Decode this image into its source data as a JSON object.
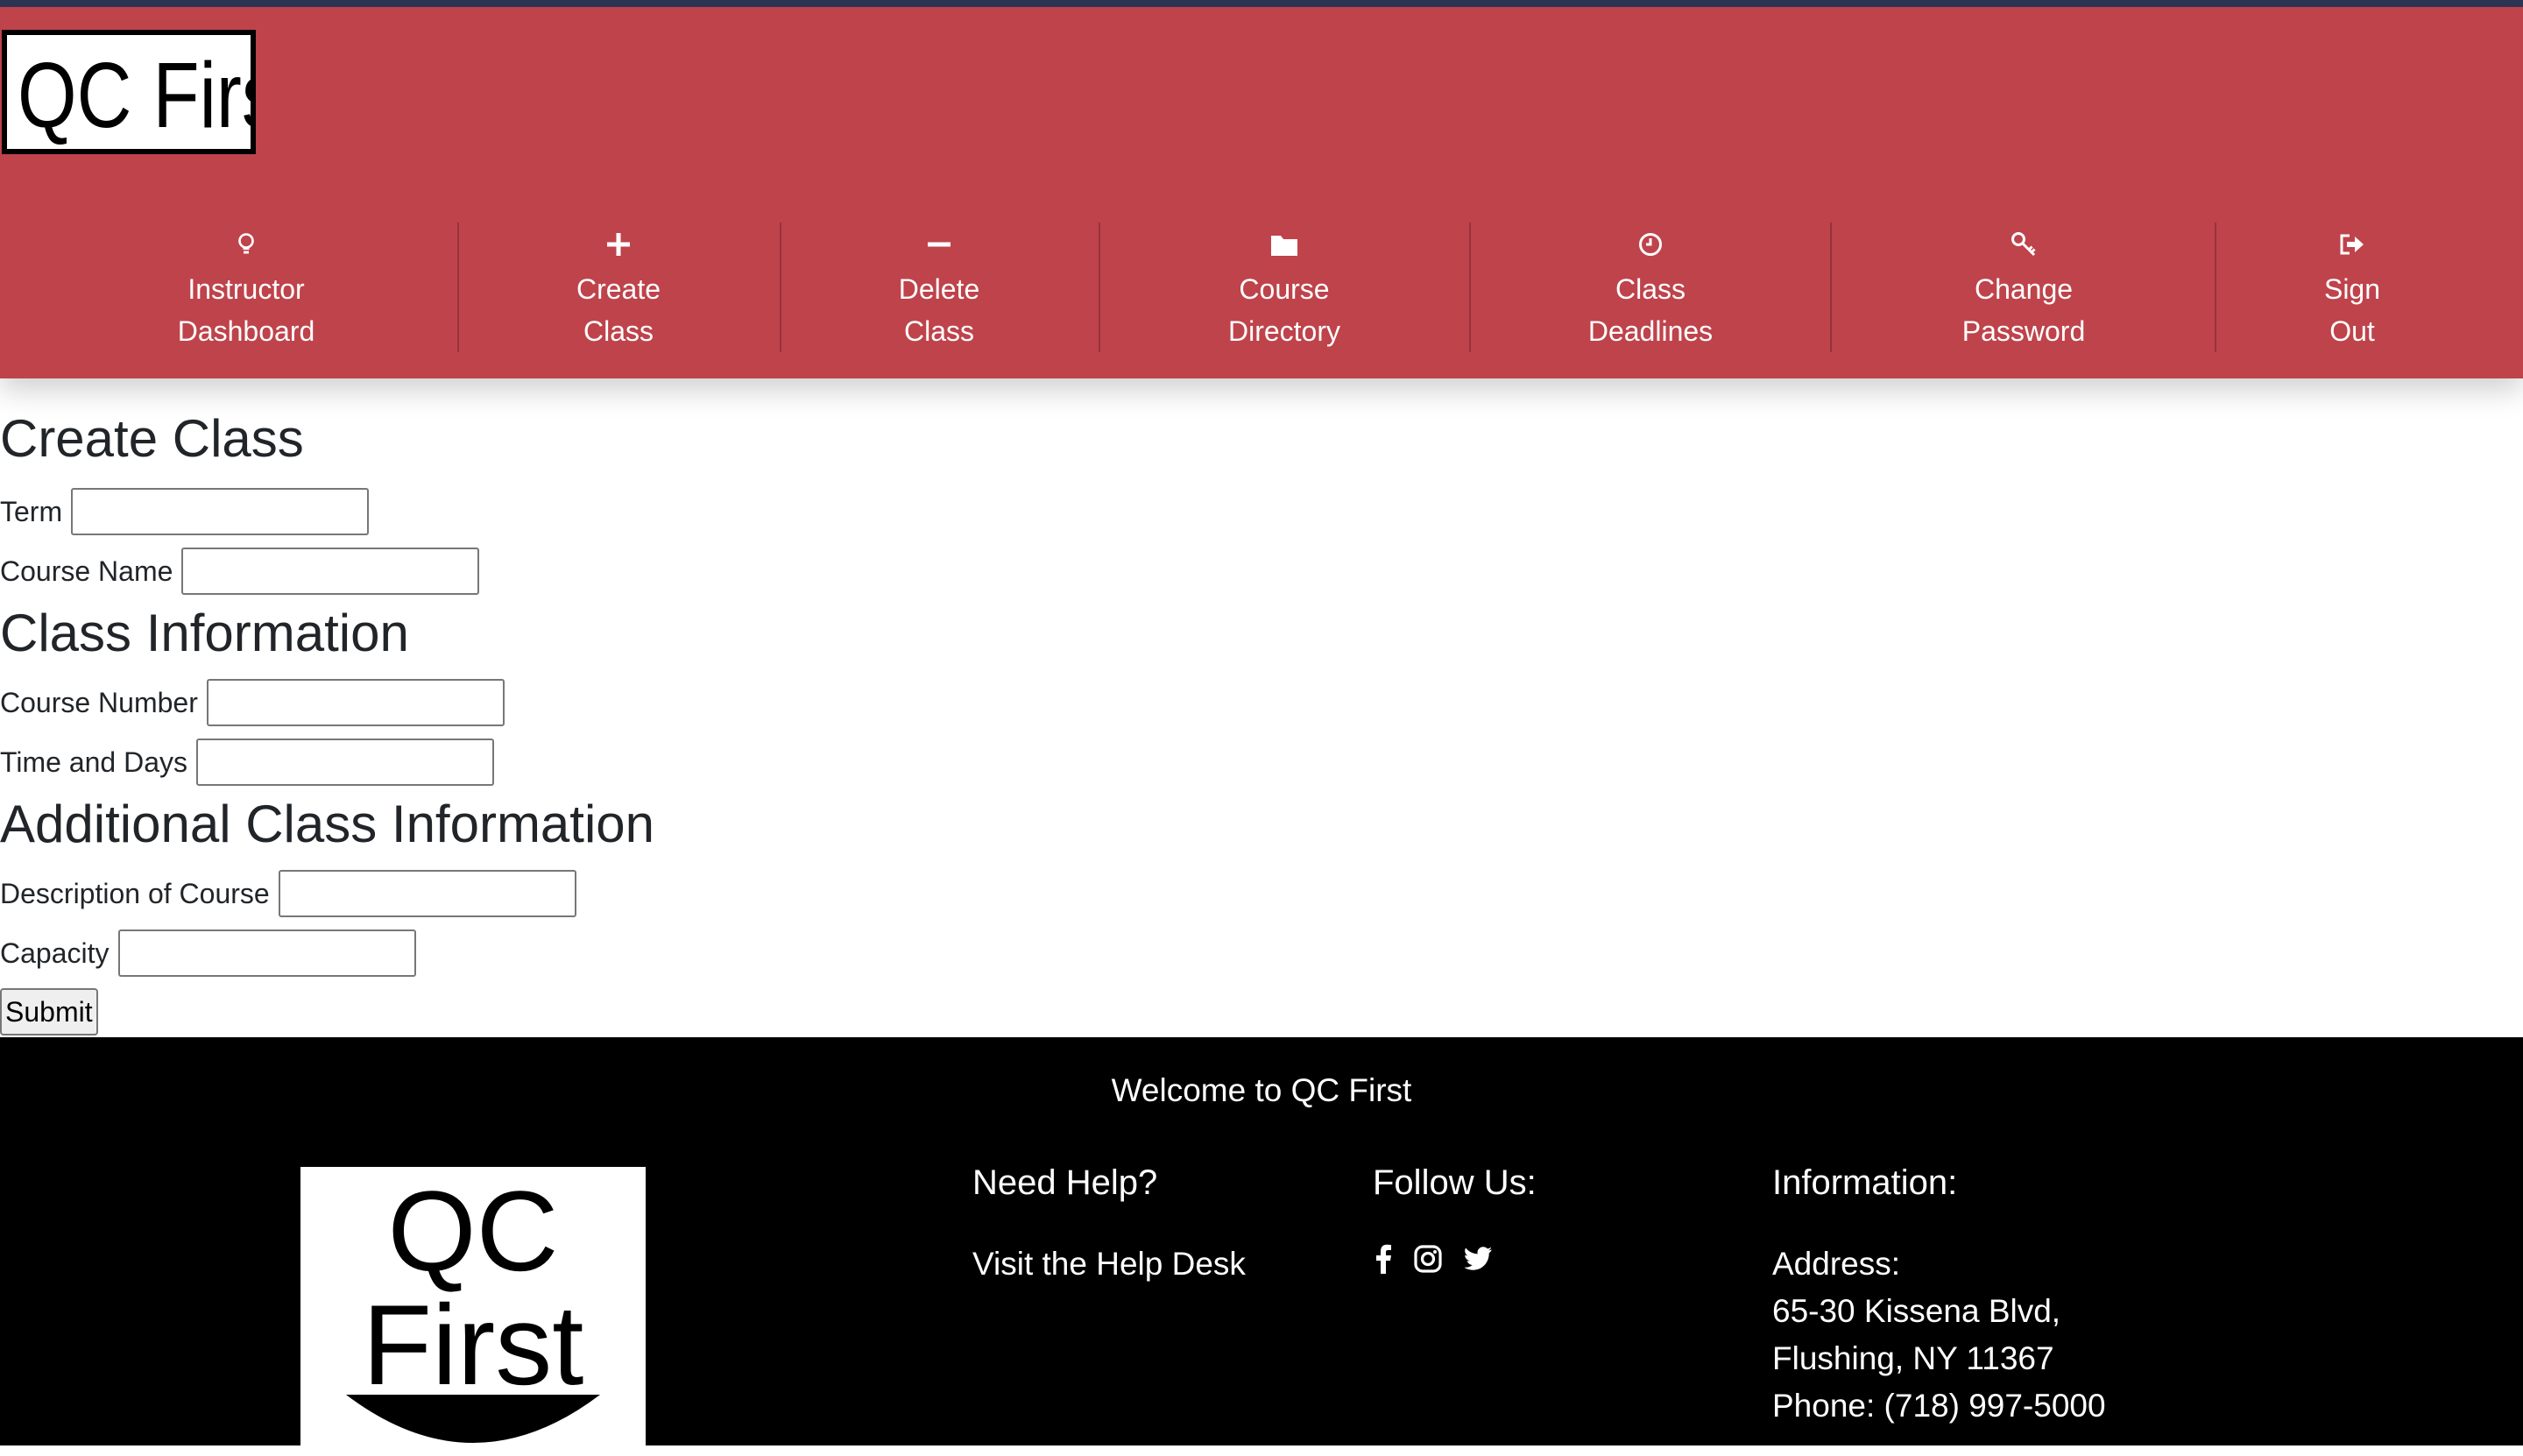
{
  "brand": {
    "logo_text": "QC First"
  },
  "nav": {
    "items": [
      {
        "line1": "Instructor",
        "line2": "Dashboard",
        "icon": "lightbulb-icon"
      },
      {
        "line1": "Create",
        "line2": "Class",
        "icon": "plus-icon"
      },
      {
        "line1": "Delete",
        "line2": "Class",
        "icon": "minus-icon"
      },
      {
        "line1": "Course",
        "line2": "Directory",
        "icon": "folder-icon"
      },
      {
        "line1": "Class",
        "line2": "Deadlines",
        "icon": "clock-icon"
      },
      {
        "line1": "Change",
        "line2": "Password",
        "icon": "key-icon"
      },
      {
        "line1": "Sign",
        "line2": "Out",
        "icon": "sign-out-icon"
      }
    ]
  },
  "form": {
    "title": "Create Class",
    "term_label": "Term",
    "course_name_label": "Course Name",
    "section2_title": "Class Information",
    "course_number_label": "Course Number",
    "time_days_label": "Time and Days",
    "section3_title": "Additional Class Information",
    "description_label": "Description of Course",
    "capacity_label": "Capacity",
    "submit_label": "Submit"
  },
  "footer": {
    "welcome": "Welcome to QC First",
    "logo_line1": "QC",
    "logo_line2": "First",
    "help_heading": "Need Help?",
    "help_link": "Visit the Help Desk",
    "follow_heading": "Follow Us:",
    "social": [
      "facebook-icon",
      "instagram-icon",
      "twitter-icon"
    ],
    "info_heading": "Information:",
    "address_label": "Address:",
    "address_line1": "65-30 Kissena Blvd,",
    "address_line2": "Flushing, NY 11367",
    "phone": "Phone: (718) 997-5000"
  },
  "colors": {
    "header_bg": "#bf434b",
    "footer_bg": "#000000",
    "top_line": "#2c3553"
  }
}
